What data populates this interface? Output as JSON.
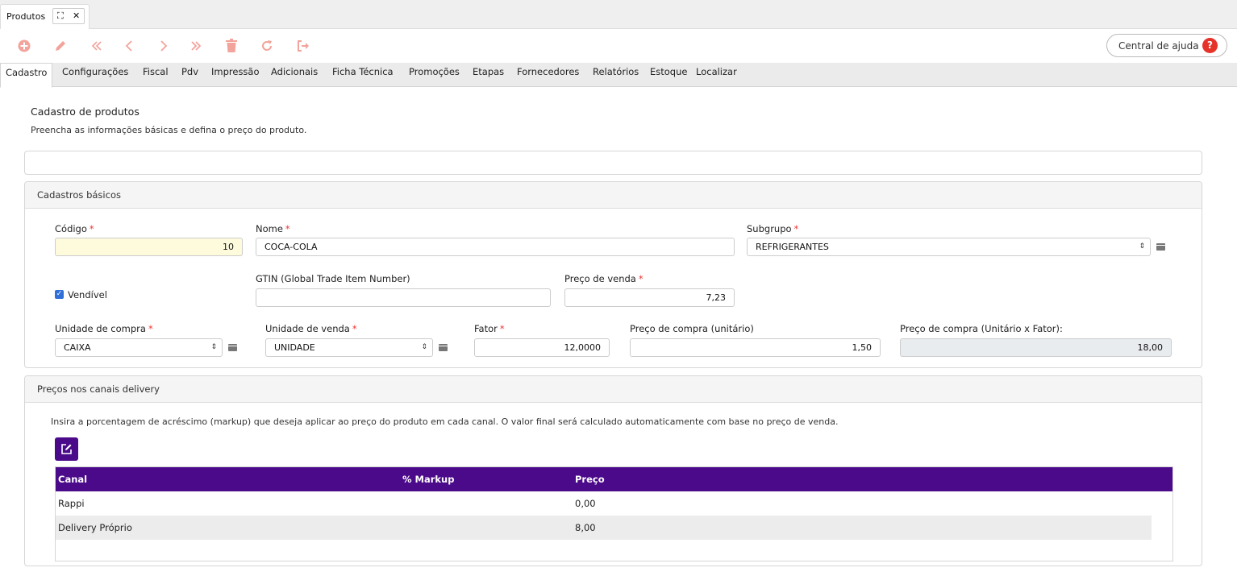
{
  "doc_tab": {
    "title": "Produtos",
    "expand_glyph": "⛶",
    "close_glyph": "✕"
  },
  "toolbar": {
    "icons": [
      "add-icon",
      "edit-icon",
      "first-icon",
      "previous-icon",
      "next-icon",
      "last-icon",
      "delete-icon",
      "refresh-icon",
      "exit-icon"
    ],
    "icon_color": "#f2a39b",
    "help_label": "Central de ajuda",
    "help_glyph": "?"
  },
  "nav_tabs": [
    "Cadastro",
    "Configurações",
    "Fiscal",
    "Pdv",
    "Impressão",
    "Adicionais",
    "Ficha Técnica",
    "Promoções",
    "Etapas",
    "Fornecedores",
    "Relatórios",
    "Estoque",
    "Localizar"
  ],
  "page": {
    "title": "Cadastro de produtos",
    "subtitle": "Preencha as informações básicas e defina o preço do produto."
  },
  "basic": {
    "header": "Cadastros básicos",
    "codigo_label": "Código",
    "codigo_value": "10",
    "nome_label": "Nome",
    "nome_value": "COCA-COLA",
    "subgrupo_label": "Subgrupo",
    "subgrupo_value": "REFRIGERANTES",
    "vendivel_label": "Vendível",
    "gtin_label": "GTIN (Global Trade Item Number)",
    "gtin_value": "",
    "preco_venda_label": "Preço de venda",
    "preco_venda_value": "7,23",
    "unidade_compra_label": "Unidade de compra",
    "unidade_compra_value": "CAIXA",
    "unidade_venda_label": "Unidade de venda",
    "unidade_venda_value": "UNIDADE",
    "fator_label": "Fator",
    "fator_value": "12,0000",
    "preco_compra_label": "Preço de compra (unitário)",
    "preco_compra_value": "1,50",
    "preco_total_label": "Preço de compra (Unitário x Fator):",
    "preco_total_value": "18,00",
    "required_mark": "*"
  },
  "delivery": {
    "header": "Preços nos canais delivery",
    "description": "Insira a porcentagem de acréscimo (markup) que deseja aplicar ao preço do produto em cada canal. O valor final será calculado automaticamente com base no preço de venda.",
    "columns": [
      "Canal",
      "% Markup",
      "Preço"
    ],
    "rows": [
      {
        "canal": "Rappi",
        "markup": "",
        "preco": "0,00"
      },
      {
        "canal": "Delivery Próprio",
        "markup": "",
        "preco": "8,00"
      }
    ]
  },
  "colors": {
    "accent": "#4b0a8a",
    "help_red": "#e6332a",
    "required": "#e33333"
  }
}
